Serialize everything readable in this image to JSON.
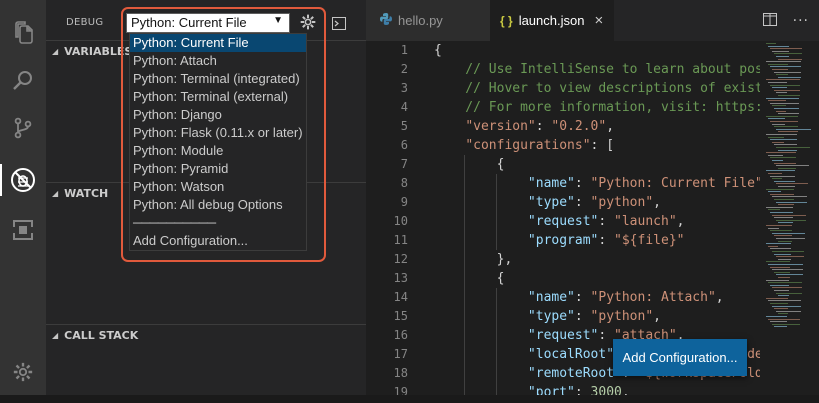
{
  "activity_bar": {
    "items": [
      {
        "icon": "files-icon"
      },
      {
        "icon": "search-icon"
      },
      {
        "icon": "source-control-icon"
      },
      {
        "icon": "debug-icon"
      },
      {
        "icon": "extensions-icon"
      }
    ],
    "settings_icon": "gear-icon"
  },
  "debug": {
    "label": "DEBUG",
    "selected_config": "Python: Current File",
    "sections": {
      "variables": "VARIABLES",
      "watch": "WATCH",
      "call_stack": "CALL STACK"
    }
  },
  "dropdown": {
    "items": [
      "Python: Current File",
      "Python: Attach",
      "Python: Terminal (integrated)",
      "Python: Terminal (external)",
      "Python: Django",
      "Python: Flask (0.11.x or later)",
      "Python: Module",
      "Python: Pyramid",
      "Python: Watson",
      "Python: All debug Options"
    ],
    "separator": "──────────",
    "add": "Add Configuration..."
  },
  "tabs": [
    {
      "label": "hello.py",
      "icon": "python-file-icon",
      "active": false
    },
    {
      "label": "launch.json",
      "icon": "json-file-icon",
      "active": true,
      "close": "×"
    }
  ],
  "editor": {
    "line_numbers": [
      "1",
      "2",
      "3",
      "4",
      "5",
      "6",
      "7",
      "8",
      "9",
      "10",
      "11",
      "12",
      "13",
      "14",
      "15",
      "16",
      "17",
      "18",
      "19"
    ]
  },
  "add_configuration_button": "Add Configuration...",
  "colors": {
    "accent": "#0e639c",
    "highlight_ring": "#e15a3c",
    "selected_item": "#094771"
  }
}
